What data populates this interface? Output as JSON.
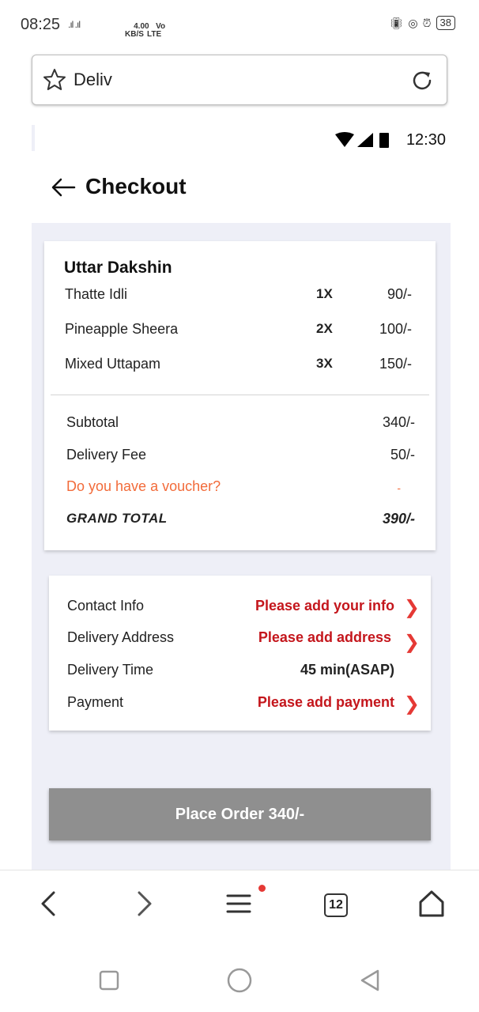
{
  "status_bar": {
    "time": "08:25",
    "signal": ".ıl .ıl",
    "speed": "4.00\nKB/S",
    "net_type": "Vo\nLTE",
    "battery": "38"
  },
  "browser": {
    "address_text": "Deliv",
    "tabs_count": "12"
  },
  "app": {
    "status_time": "12:30",
    "title": "Checkout",
    "restaurant": "Uttar Dakshin",
    "items": [
      {
        "name": "Thatte Idli",
        "qty": "1X",
        "price": "90/-"
      },
      {
        "name": "Pineapple Sheera",
        "qty": "2X",
        "price": "100/-"
      },
      {
        "name": "Mixed Uttapam",
        "qty": "3X",
        "price": "150/-"
      }
    ],
    "summary": {
      "subtotal_label": "Subtotal",
      "subtotal_value": "340/-",
      "delivery_label": "Delivery Fee",
      "delivery_value": "50/-",
      "voucher_label": "Do you have a voucher?",
      "voucher_value": "-",
      "grand_label": "GRAND TOTAL",
      "grand_value": "390/-"
    },
    "info": {
      "contact_label": "Contact Info",
      "contact_value": "Please add  your info",
      "address_label": "Delivery Address",
      "address_value": "Please add address",
      "time_label": "Delivery Time",
      "time_value": "45 min(ASAP)",
      "payment_label": "Payment",
      "payment_value": "Please add payment"
    },
    "place_order_label": "Place Order 340/-"
  },
  "colors": {
    "accent_red": "#c4161c",
    "voucher_orange": "#f26b3a",
    "background": "#eeeff7",
    "button_gray": "#8f8f8f"
  },
  "icons": [
    "star-icon",
    "reload-icon",
    "back-arrow-icon",
    "chevron-right-icon",
    "back-icon",
    "forward-icon",
    "menu-icon",
    "tabs-icon",
    "home-icon",
    "recent-apps-icon",
    "home-circle-icon",
    "nav-back-icon",
    "wifi-icon",
    "cell-signal-icon",
    "battery-icon"
  ]
}
